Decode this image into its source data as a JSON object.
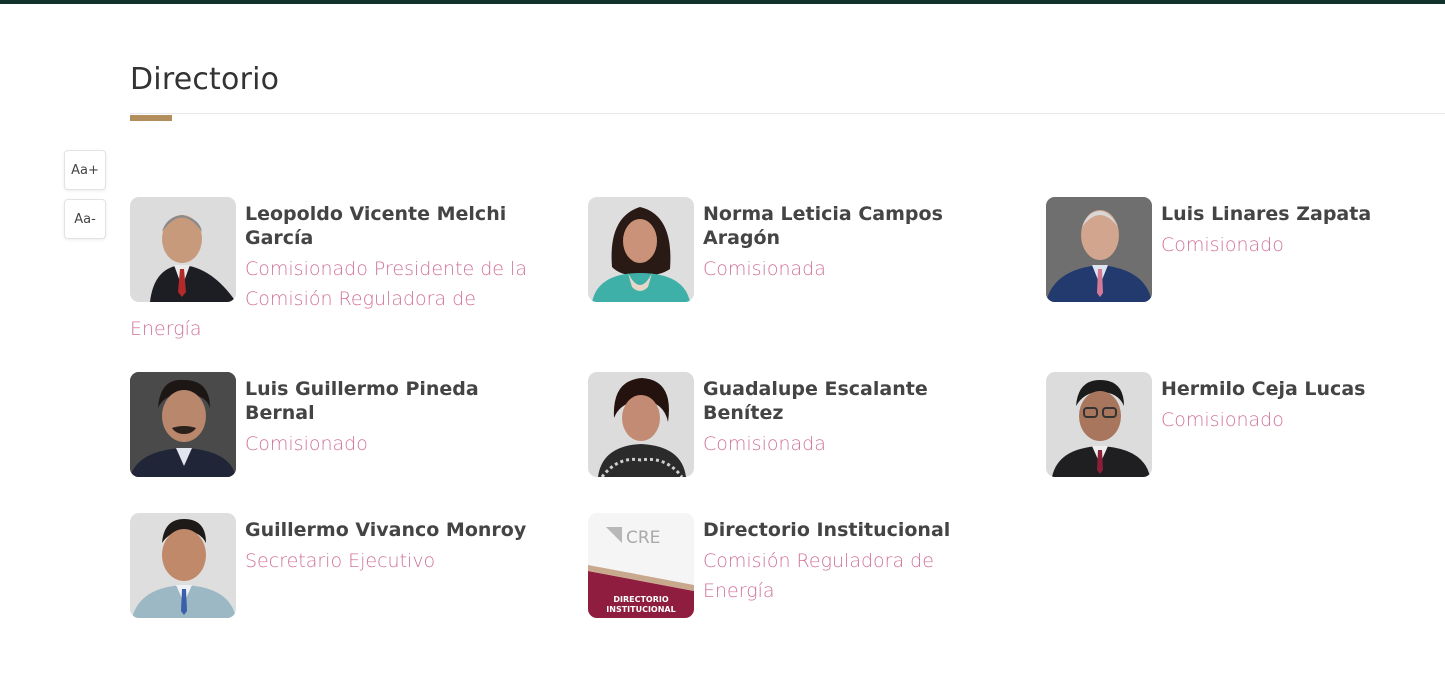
{
  "section": {
    "title": "Directorio",
    "font_increase_label": "Aa+",
    "font_decrease_label": "Aa-"
  },
  "colors": {
    "top_bar": "#13322b",
    "accent": "#b38e5d",
    "role_text": "#d0739a",
    "name_text": "#444444"
  },
  "directory": [
    {
      "name": "Leopoldo Vicente Melchi García",
      "role": "Comisionado Presidente de la Comisión Reguladora de Energía"
    },
    {
      "name": "Norma Leticia Campos Aragón",
      "role": "Comisionada"
    },
    {
      "name": "Luis Linares Zapata",
      "role": "Comisionado"
    },
    {
      "name": "Luis Guillermo Pineda Bernal",
      "role": "Comisionado"
    },
    {
      "name": "Guadalupe Escalante Benítez",
      "role": "Comisionada"
    },
    {
      "name": "Hermilo Ceja Lucas",
      "role": "Comisionado"
    },
    {
      "name": "Guillermo Vivanco Monroy",
      "role": "Secretario Ejecutivo"
    },
    {
      "name": "Directorio Institucional",
      "role": "Comisión Reguladora de Energía"
    }
  ],
  "institutional_image": {
    "logo_text": "CRE",
    "banner_line1": "DIRECTORIO",
    "banner_line2": "INSTITUCIONAL"
  }
}
